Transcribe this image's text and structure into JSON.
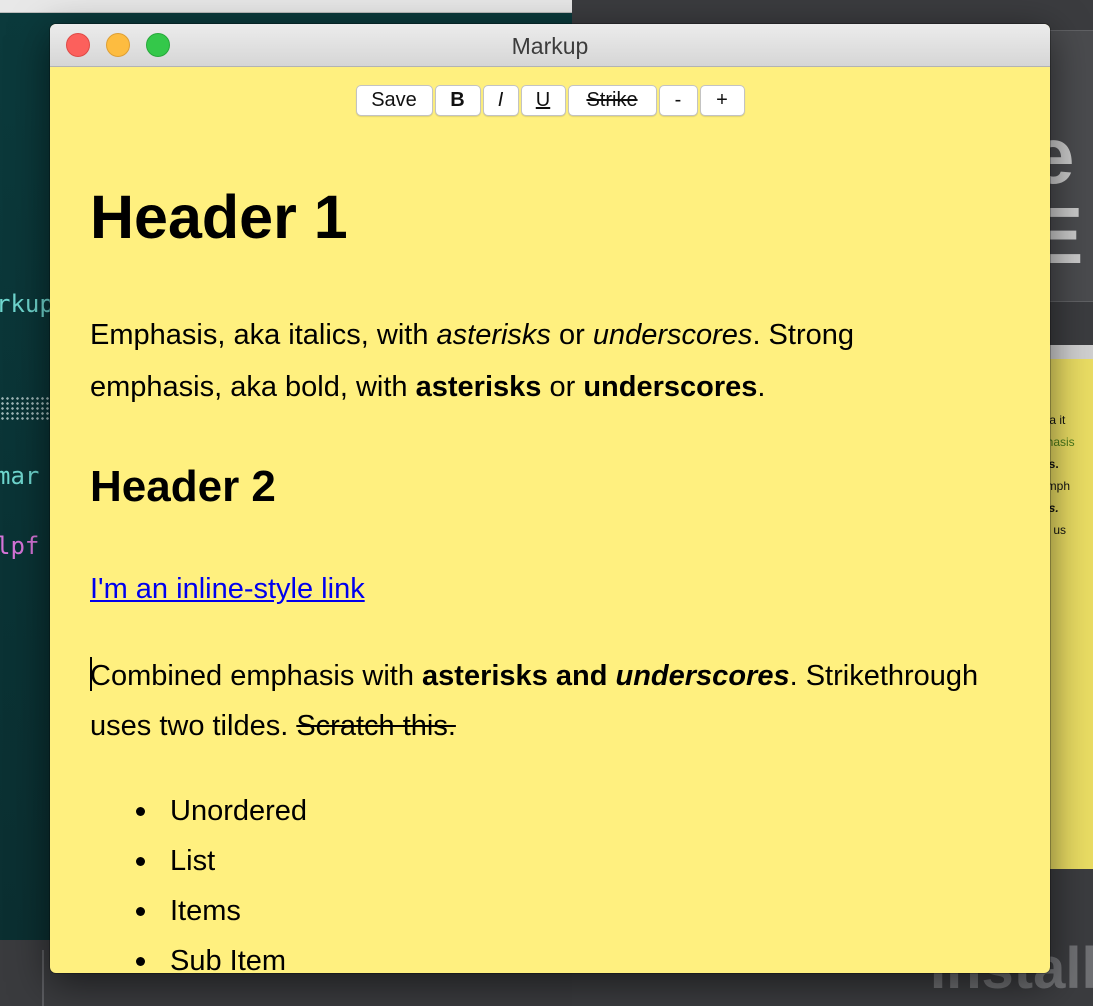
{
  "window": {
    "title": "Markup"
  },
  "toolbar": {
    "save": "Save",
    "bold": "B",
    "italic": "I",
    "underline": "U",
    "strike": "Strike",
    "decrease": "-",
    "increase": "+"
  },
  "document": {
    "h1": "Header 1",
    "p1": {
      "t1": "Emphasis, aka italics, with ",
      "em1": "asterisks",
      "t2": " or ",
      "em2": "underscores",
      "t3": ". Strong emphasis, aka bold, with ",
      "strong1": "asterisks",
      "t4": " or ",
      "strong2": "underscores",
      "t5": "."
    },
    "h2": "Header 2",
    "link": "I'm an inline-style link",
    "p2": {
      "t1": "Combined emphasis with ",
      "strong": "asterisks and ",
      "strong_em": "underscores",
      "t2": ". Strikethrough uses two tildes. ",
      "strike": "Scratch this."
    },
    "list": [
      "Unordered",
      "List",
      "Items",
      "Sub Item"
    ]
  },
  "background": {
    "code_lines": [
      "rkup",
      "mar",
      "lpf"
    ],
    "big_text": [
      "e I",
      "E"
    ],
    "preview_lines": [
      ", aka it",
      "mphasis",
      "ores.",
      "d emph",
      "ores.",
      "ugh us"
    ],
    "install_text": "Install"
  },
  "colors": {
    "window_background": "#fff07f",
    "link": "#0000ee",
    "close": "#fc605c",
    "minimize": "#fdbc40",
    "maximize": "#34c84a"
  }
}
